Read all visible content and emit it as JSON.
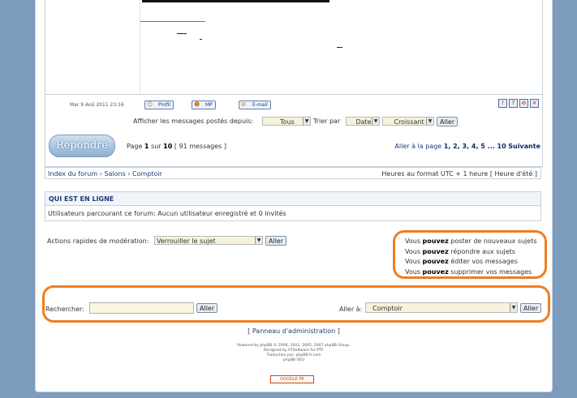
{
  "post": {
    "date": "Mar 9 Aoû 2011 23:16",
    "buttons": {
      "profile": "Profil",
      "pm": "MP",
      "email": "E-mail"
    },
    "action_icons": [
      "!",
      "?",
      "⊘",
      "×"
    ]
  },
  "sort": {
    "display_label": "Afficher les messages postés depuis:",
    "display_value": "Tous",
    "sort_label": "Trier par",
    "sort_value": "Date",
    "order_value": "Croissant",
    "go": "Aller"
  },
  "pagination": {
    "reply_label": "Repondre",
    "page_prefix": "Page",
    "page_current": "1",
    "page_mid": "sur",
    "page_total": "10",
    "messages": "[ 91 messages ]",
    "goto_prefix": "Aller à la page",
    "pages": "1, 2, 3, 4, 5 ... 10",
    "next": "Suivante"
  },
  "breadcrumb": {
    "items": [
      "Index du forum",
      "Salons",
      "Comptoir"
    ],
    "sep": "›",
    "timezone": "Heures au format UTC + 1 heure [ Heure d'été ]"
  },
  "whois": {
    "title": "QUI EST EN LIGNE",
    "text": "Utilisateurs parcourant ce forum: Aucun utilisateur enregistré et 0 invités"
  },
  "moderation": {
    "label": "Actions rapides de modération:",
    "value": "Verrouiller le sujet",
    "go": "Aller"
  },
  "permissions": [
    {
      "pre": "Vous",
      "strong": "pouvez",
      "post": "poster de nouveaux sujets"
    },
    {
      "pre": "Vous",
      "strong": "pouvez",
      "post": "répondre aux sujets"
    },
    {
      "pre": "Vous",
      "strong": "pouvez",
      "post": "éditer vos messages"
    },
    {
      "pre": "Vous",
      "strong": "pouvez",
      "post": "supprimer vos messages"
    }
  ],
  "search": {
    "label": "Rechercher:",
    "value": "",
    "go": "Aller"
  },
  "jump": {
    "label": "Aller à:",
    "value": "Comptoir",
    "go": "Aller"
  },
  "admin_link": "[ Panneau d'administration ]",
  "footer": {
    "line1": "Powered by phpBB © 2000, 2002, 2005, 2007 phpBB Group.",
    "line2": "Designed by STSoftware for PTF.",
    "line3": "Traduction par: phpBB-fr.com",
    "line4": "phpBB SEO",
    "badge": "GOOGLE PR"
  },
  "colors": {
    "accent": "#f07d21",
    "background": "#7d9bbd",
    "link": "#1a3d7a"
  }
}
